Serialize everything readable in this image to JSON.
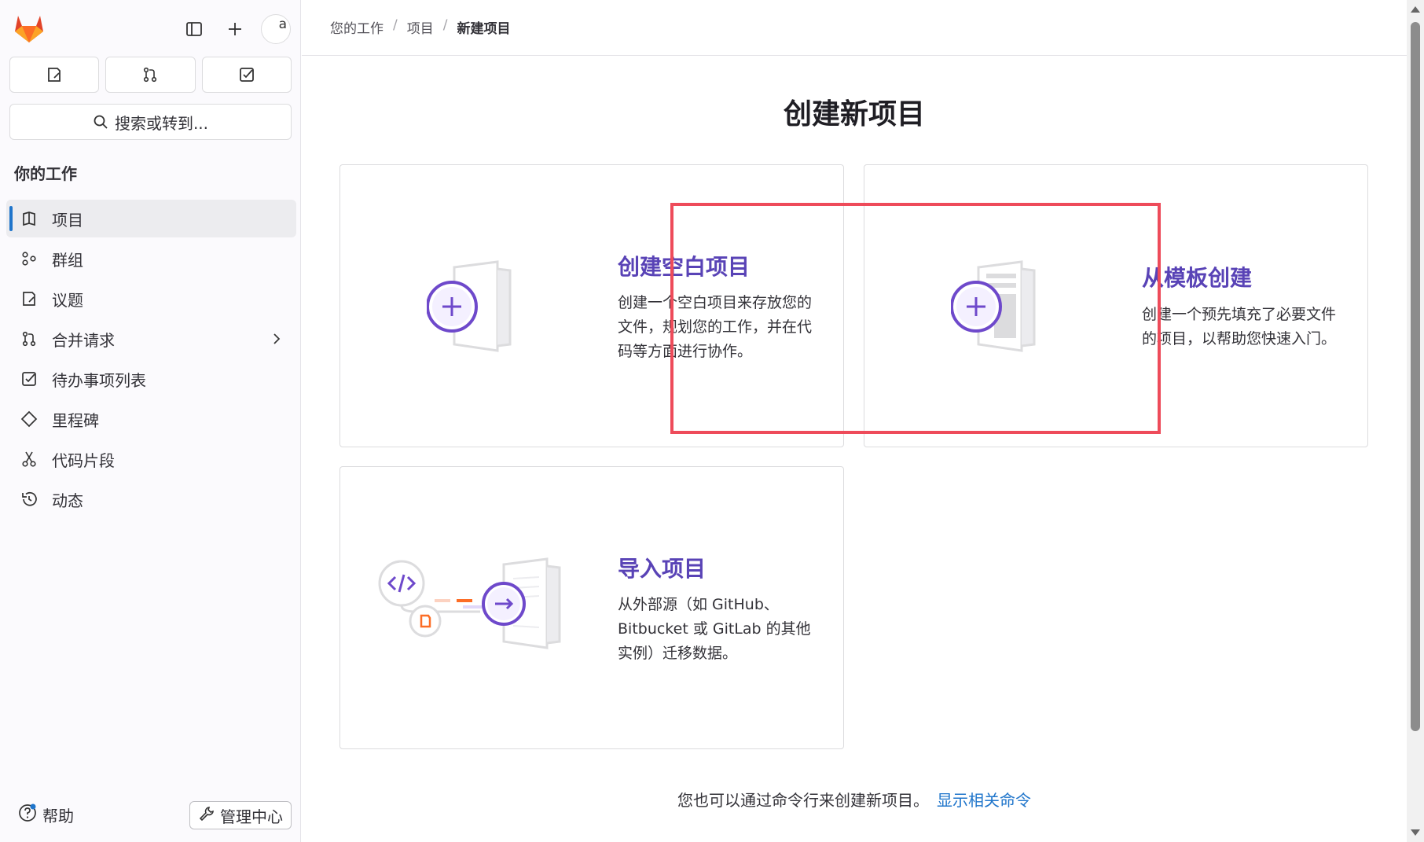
{
  "sidebar": {
    "logo": "gitlab-tanuki-logo",
    "avatar_text": "a",
    "search_label": "搜索或转到...",
    "section_title": "你的工作",
    "items": [
      {
        "label": "项目",
        "icon": "project-icon",
        "active": true
      },
      {
        "label": "群组",
        "icon": "group-icon"
      },
      {
        "label": "议题",
        "icon": "issues-icon"
      },
      {
        "label": "合并请求",
        "icon": "merge-request-icon",
        "has_chevron": true
      },
      {
        "label": "待办事项列表",
        "icon": "todo-icon"
      },
      {
        "label": "里程碑",
        "icon": "milestone-icon"
      },
      {
        "label": "代码片段",
        "icon": "snippet-icon"
      },
      {
        "label": "动态",
        "icon": "history-icon"
      }
    ],
    "help_label": "帮助",
    "admin_label": "管理中心"
  },
  "breadcrumb": {
    "items": [
      "您的工作",
      "项目",
      "新建项目"
    ]
  },
  "page_title": "创建新项目",
  "cards": {
    "blank": {
      "title": "创建空白项目",
      "desc_lines": [
        "创建一个空白项目来存放您的",
        "文件，规划您的工作，并在代",
        "码等方面进行协作。"
      ]
    },
    "template": {
      "title": "从模板创建",
      "desc_lines": [
        "创建一个预先填充了必要文件",
        "的项目，以帮助您快速入门。"
      ]
    },
    "import": {
      "title": "导入项目",
      "desc_lines": [
        "从外部源（如 GitHub、",
        "Bitbucket 或 GitLab 的其他",
        "实例）迁移数据。"
      ]
    }
  },
  "footer": {
    "note": "您也可以通过命令行来创建新项目。",
    "link": "显示相关命令"
  },
  "colors": {
    "accent_purple": "#5943b6",
    "link_blue": "#1f75cb",
    "highlight_red": "#ee4b5a",
    "active_bar": "#1f75cb"
  }
}
